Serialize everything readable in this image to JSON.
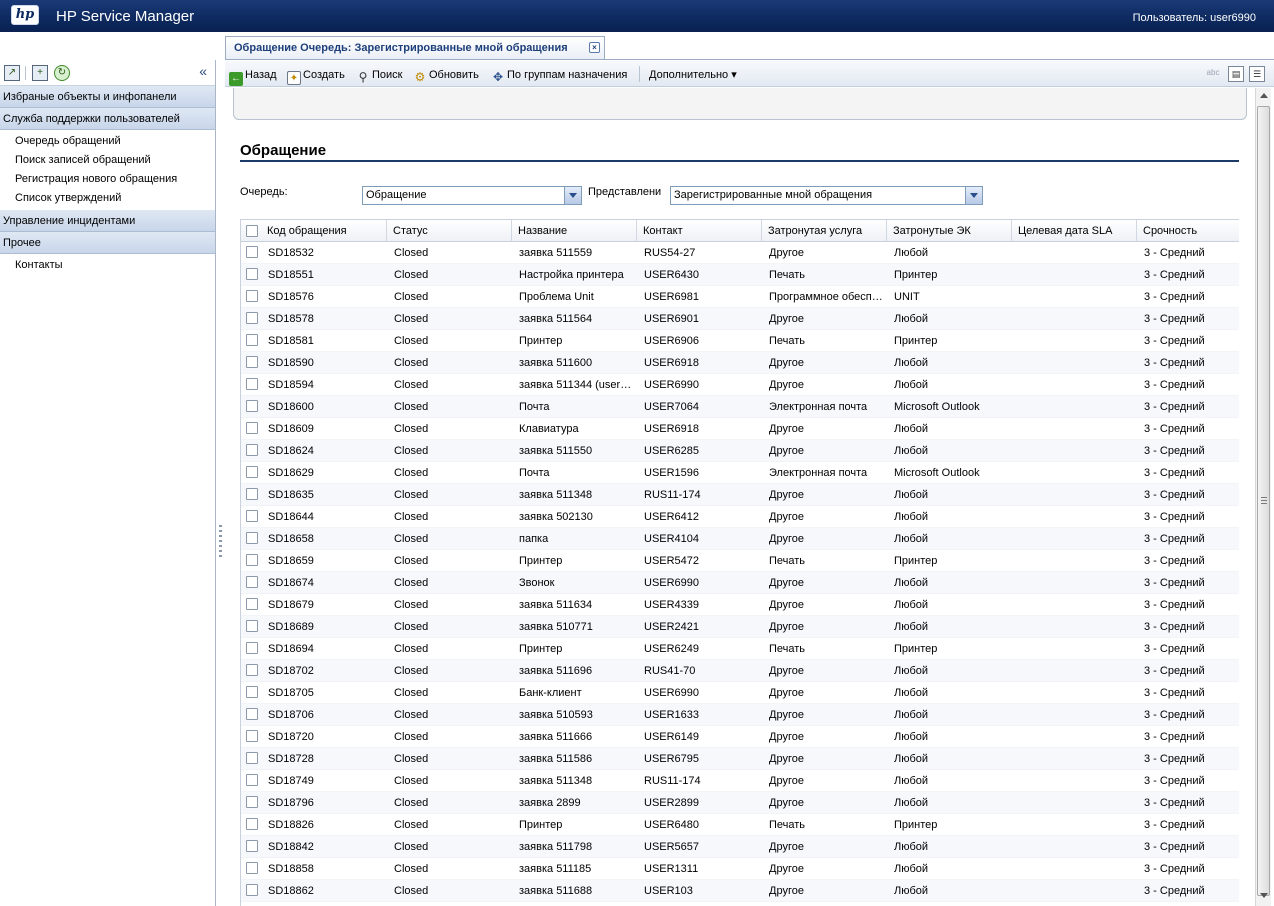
{
  "banner": {
    "logo_text": "hp",
    "app_title": "HP Service Manager",
    "user_label": "Пользователь: user6990"
  },
  "left_panel": {
    "collapse_symbol": "«",
    "sections": [
      {
        "label": "Избраные объекты и инфопанели",
        "items": []
      },
      {
        "label": "Служба поддержки пользователей",
        "items": [
          "Очередь обращений",
          "Поиск записей обращений",
          "Регистрация нового обращения",
          "Список утверждений"
        ]
      },
      {
        "label": "Управление инцидентами",
        "items": []
      },
      {
        "label": "Прочее",
        "items": [
          "Контакты"
        ]
      }
    ]
  },
  "tab": {
    "label": "Обращение Очередь: Зарегистрированные мной обращения",
    "close_symbol": "×"
  },
  "toolbar": {
    "back": "Назад",
    "create": "Создать",
    "search": "Поиск",
    "refresh": "Обновить",
    "by_groups": "По группам назначения",
    "more": "Дополнительно",
    "more_arrow": "▾",
    "spell_icon_text": "abc"
  },
  "form": {
    "heading": "Обращение",
    "queue_label": "Очередь:",
    "queue_value": "Обращение",
    "view_label": "Представлени",
    "view_value": "Зарегистрированные мной обращения"
  },
  "table": {
    "columns": [
      "Код обращения",
      "Статус",
      "Название",
      "Контакт",
      "Затронутая услуга",
      "Затронутые ЭК",
      "Целевая дата SLA",
      "Срочность"
    ],
    "rows": [
      [
        "SD18532",
        "Closed",
        "заявка 511559",
        "RUS54-27",
        "Другое",
        "Любой",
        "",
        "3 - Средний"
      ],
      [
        "SD18551",
        "Closed",
        "Настройка принтера",
        "USER6430",
        "Печать",
        "Принтер",
        "",
        "3 - Средний"
      ],
      [
        "SD18576",
        "Closed",
        "Проблема Unit",
        "USER6981",
        "Программное обеспе...",
        "UNIT",
        "",
        "3 - Средний"
      ],
      [
        "SD18578",
        "Closed",
        "заявка 511564",
        "USER6901",
        "Другое",
        "Любой",
        "",
        "3 - Средний"
      ],
      [
        "SD18581",
        "Closed",
        "Принтер",
        "USER6906",
        "Печать",
        "Принтер",
        "",
        "3 - Средний"
      ],
      [
        "SD18590",
        "Closed",
        "заявка 511600",
        "USER6918",
        "Другое",
        "Любой",
        "",
        "3 - Средний"
      ],
      [
        "SD18594",
        "Closed",
        "заявка 511344 (user7...",
        "USER6990",
        "Другое",
        "Любой",
        "",
        "3 - Средний"
      ],
      [
        "SD18600",
        "Closed",
        "Почта",
        "USER7064",
        "Электронная почта",
        "Microsoft Outlook",
        "",
        "3 - Средний"
      ],
      [
        "SD18609",
        "Closed",
        "Клавиатура",
        "USER6918",
        "Другое",
        "Любой",
        "",
        "3 - Средний"
      ],
      [
        "SD18624",
        "Closed",
        "заявка 511550",
        "USER6285",
        "Другое",
        "Любой",
        "",
        "3 - Средний"
      ],
      [
        "SD18629",
        "Closed",
        "Почта",
        "USER1596",
        "Электронная почта",
        "Microsoft Outlook",
        "",
        "3 - Средний"
      ],
      [
        "SD18635",
        "Closed",
        "заявка 511348",
        "RUS11-174",
        "Другое",
        "Любой",
        "",
        "3 - Средний"
      ],
      [
        "SD18644",
        "Closed",
        "заявка 502130",
        "USER6412",
        "Другое",
        "Любой",
        "",
        "3 - Средний"
      ],
      [
        "SD18658",
        "Closed",
        "папка",
        "USER4104",
        "Другое",
        "Любой",
        "",
        "3 - Средний"
      ],
      [
        "SD18659",
        "Closed",
        "Принтер",
        "USER5472",
        "Печать",
        "Принтер",
        "",
        "3 - Средний"
      ],
      [
        "SD18674",
        "Closed",
        "Звонок",
        "USER6990",
        "Другое",
        "Любой",
        "",
        "3 - Средний"
      ],
      [
        "SD18679",
        "Closed",
        "заявка 511634",
        "USER4339",
        "Другое",
        "Любой",
        "",
        "3 - Средний"
      ],
      [
        "SD18689",
        "Closed",
        "заявка 510771",
        "USER2421",
        "Другое",
        "Любой",
        "",
        "3 - Средний"
      ],
      [
        "SD18694",
        "Closed",
        "Принтер",
        "USER6249",
        "Печать",
        "Принтер",
        "",
        "3 - Средний"
      ],
      [
        "SD18702",
        "Closed",
        "заявка 511696",
        "RUS41-70",
        "Другое",
        "Любой",
        "",
        "3 - Средний"
      ],
      [
        "SD18705",
        "Closed",
        "Банк-клиент",
        "USER6990",
        "Другое",
        "Любой",
        "",
        "3 - Средний"
      ],
      [
        "SD18706",
        "Closed",
        "заявка 510593",
        "USER1633",
        "Другое",
        "Любой",
        "",
        "3 - Средний"
      ],
      [
        "SD18720",
        "Closed",
        "заявка 511666",
        "USER6149",
        "Другое",
        "Любой",
        "",
        "3 - Средний"
      ],
      [
        "SD18728",
        "Closed",
        "заявка 511586",
        "USER6795",
        "Другое",
        "Любой",
        "",
        "3 - Средний"
      ],
      [
        "SD18749",
        "Closed",
        "заявка 511348",
        "RUS11-174",
        "Другое",
        "Любой",
        "",
        "3 - Средний"
      ],
      [
        "SD18796",
        "Closed",
        "заявка 2899",
        "USER2899",
        "Другое",
        "Любой",
        "",
        "3 - Средний"
      ],
      [
        "SD18826",
        "Closed",
        "Принтер",
        "USER6480",
        "Печать",
        "Принтер",
        "",
        "3 - Средний"
      ],
      [
        "SD18842",
        "Closed",
        "заявка 511798",
        "USER5657",
        "Другое",
        "Любой",
        "",
        "3 - Средний"
      ],
      [
        "SD18858",
        "Closed",
        "заявка 511185",
        "USER1311",
        "Другое",
        "Любой",
        "",
        "3 - Средний"
      ],
      [
        "SD18862",
        "Closed",
        "заявка 511688",
        "USER103",
        "Другое",
        "Любой",
        "",
        "3 - Средний"
      ]
    ]
  }
}
